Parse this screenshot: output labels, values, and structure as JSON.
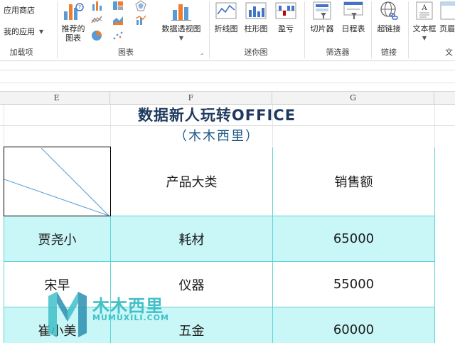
{
  "ribbon": {
    "addins": {
      "store_label": "应用商店",
      "my_apps_label": "我的应用",
      "group_label": "加载项"
    },
    "charts": {
      "recommended_label_1": "推荐的",
      "recommended_label_2": "图表",
      "pivot_chart_label": "数据透视图",
      "group_label": "图表"
    },
    "sparklines": {
      "line_label": "折线图",
      "column_label": "柱形图",
      "winloss_label": "盈亏",
      "group_label": "迷你图"
    },
    "filters": {
      "slicer_label": "切片器",
      "timeline_label": "日程表",
      "group_label": "筛选器"
    },
    "links": {
      "hyperlink_label": "超链接",
      "group_label": "链接"
    },
    "text": {
      "textbox_label": "文本框",
      "header_label": "页眉",
      "group_label": "文"
    }
  },
  "columns": [
    "E",
    "F",
    "G"
  ],
  "sheet": {
    "title": "数据新人玩转OFFICE",
    "subtitle": "（木木西里）",
    "table": {
      "headers": [
        "",
        "产品大类",
        "销售额"
      ],
      "rows": [
        [
          "贾尧小",
          "耗材",
          "65000"
        ],
        [
          "宋早",
          "仪器",
          "55000"
        ],
        [
          "崔小美",
          "五金",
          "60000"
        ]
      ]
    }
  },
  "watermark": {
    "cn": "木木西里",
    "en": "MUMUXILI.COM"
  },
  "colors": {
    "band_fill": "#c9f6f6",
    "border_cyan": "#5fd4d4",
    "title_navy": "#1f3a5f",
    "watermark": "#41c0c8"
  }
}
